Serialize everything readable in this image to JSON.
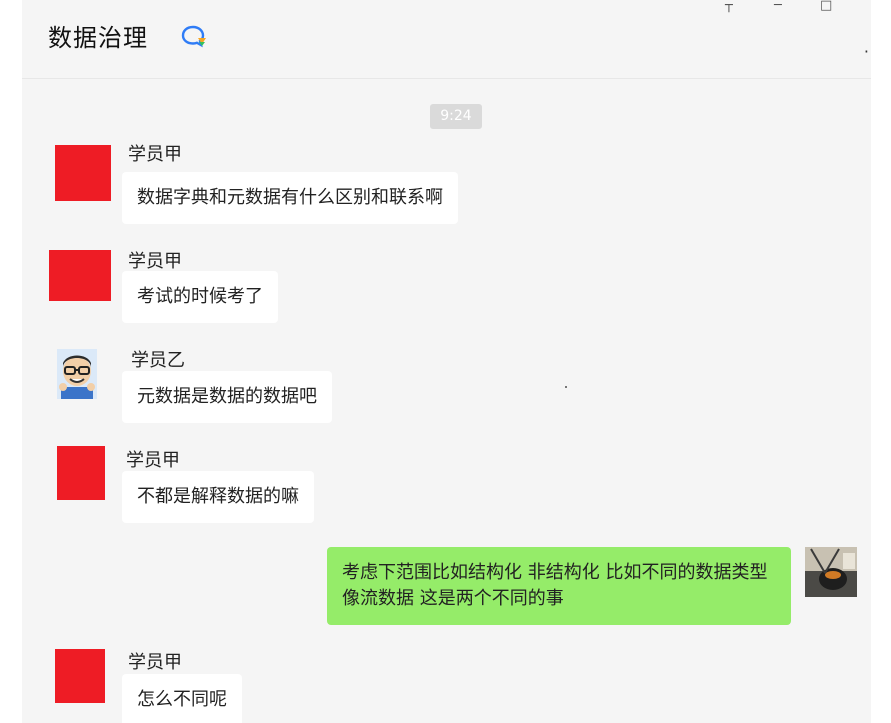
{
  "chat": {
    "title": "数据治理",
    "time": "9:24"
  },
  "messages": [
    {
      "sender": "学员甲",
      "text": "数据字典和元数据有什么区别和联系啊"
    },
    {
      "sender": "学员甲",
      "text": "考试的时候考了"
    },
    {
      "sender": "学员乙",
      "text": "元数据是数据的数据吧"
    },
    {
      "sender": "学员甲",
      "text": "不都是解释数据的嘛"
    },
    {
      "sender": "",
      "text": "考虑下范围比如结构化 非结构化 比如不同的数据类型 像流数据 这是两个不同的事"
    },
    {
      "sender": "学员甲",
      "text": "怎么不同呢"
    }
  ],
  "colors": {
    "background": "#f5f5f5",
    "self_bubble": "#95ec69",
    "other_bubble": "#ffffff",
    "red_avatar": "#ee1c25",
    "accent": "#2f7cf6"
  },
  "icons": {
    "chat_icon": "chat-bubble-icon",
    "avatar_cartoon": "cartoon-face-avatar",
    "avatar_self": "photo-avatar"
  }
}
